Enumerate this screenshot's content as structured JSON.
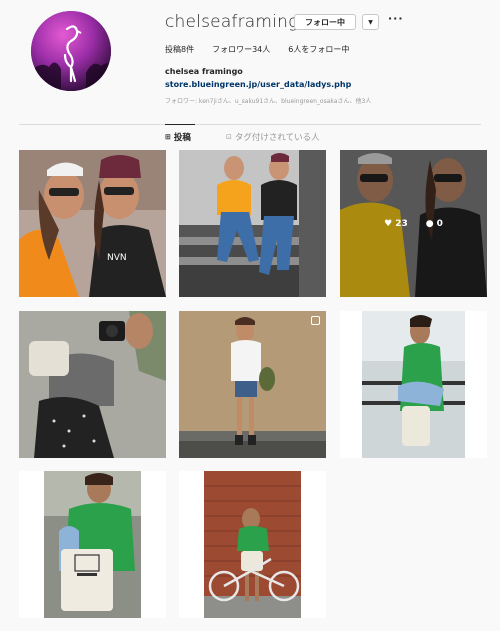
{
  "profile": {
    "username": "chelseaframingo",
    "follow_button": "フォロー中",
    "more": "···",
    "stats": {
      "posts": "投稿8件",
      "followers": "フォロワー34人",
      "following": "6人をフォロー中"
    },
    "full_name": "chelsea framingo",
    "link": "store.blueingreen.jp/user_data/ladys.php",
    "followed_by": "フォロワー: ken7jiさん、u_saku91さん、blueingreen_osakaさん、他3人"
  },
  "tabs": [
    {
      "label": "投稿",
      "icon": "grid-icon",
      "active": true
    },
    {
      "label": "タグ付けされている人",
      "icon": "tag-icon",
      "active": false
    }
  ],
  "hover_post": {
    "likes": "23",
    "comments": "0"
  },
  "colors": {
    "link": "#003569",
    "background": "#f9f9f9",
    "muted": "#999999"
  }
}
